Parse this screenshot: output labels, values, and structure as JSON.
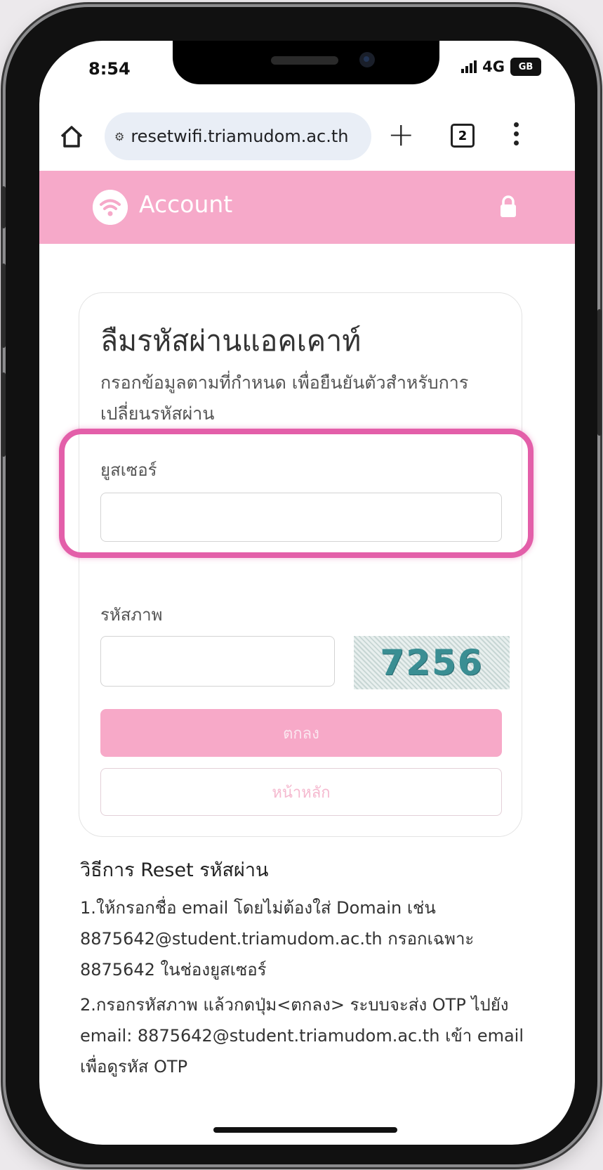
{
  "status_bar": {
    "time": "8:54",
    "network": "4G",
    "battery_label": "GB"
  },
  "browser": {
    "url": "resetwifi.triamudom.ac.th",
    "site_icon": "tune-icon",
    "tab_count": "2"
  },
  "app_header": {
    "title": "Account"
  },
  "form": {
    "title": "ลืมรหัสผ่านแอคเคาท์",
    "description": "กรอกข้อมูลตามที่กำหนด เพื่อยืนยันตัวสำหรับการเปลี่ยนรหัสผ่าน",
    "username_label": "ยูสเซอร์",
    "username_value": "",
    "captcha_label": "รหัสภาพ",
    "captcha_value": "",
    "captcha_text": "7256",
    "submit_label": "ตกลง",
    "home_label": "หน้าหลัก"
  },
  "guide": {
    "title": "วิธีการ Reset รหัสผ่าน",
    "step1": "1.ให้กรอกชื่อ email โดยไม่ต้องใส่ Domain เช่น 8875642@student.triamudom.ac.th กรอกเฉพาะ 8875642 ในช่องยูสเซอร์",
    "step2": "2.กรอกรหัสภาพ แล้วกดปุ่ม<ตกลง> ระบบจะส่ง OTP ไปยัง email: 8875642@student.triamudom.ac.th เข้า email เพื่อดูรหัส OTP"
  },
  "colors": {
    "accent": "#f6a9c9",
    "highlight": "#e35fa9"
  }
}
